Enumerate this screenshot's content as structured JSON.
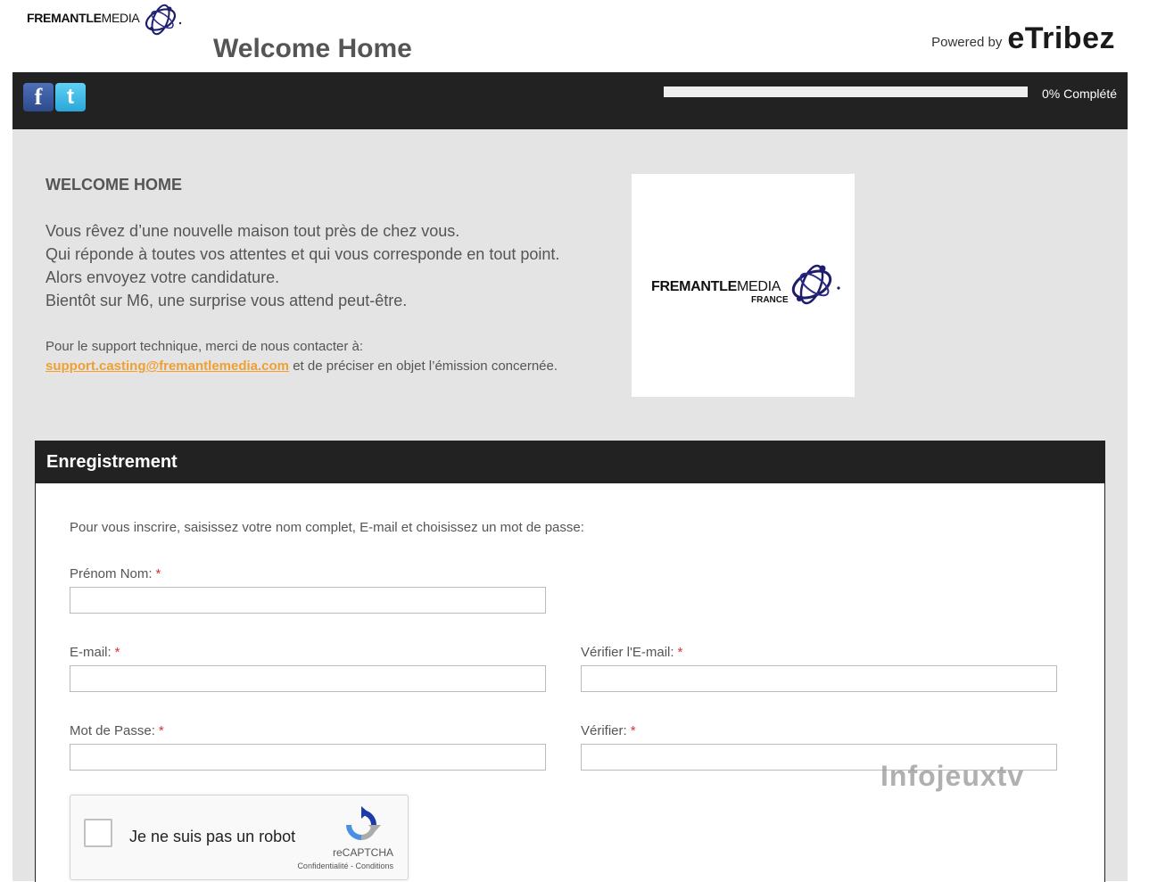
{
  "header": {
    "logo_text_bold": "FREMANTLE",
    "logo_text_light": "MEDIA",
    "title": "Welcome Home",
    "powered_by_label": "Powered by",
    "powered_by_brand": "eTribez"
  },
  "topbar": {
    "progress_value": 0,
    "progress_text": "0% Complété"
  },
  "intro": {
    "heading": "WELCOME HOME",
    "lines": [
      "Vous rêvez d’une nouvelle maison tout près de chez vous.",
      "Qui réponde à toutes vos attentes et qui vous corresponde en tout point.",
      "Alors envoyez votre candidature.",
      "Bientôt sur M6, une surprise vous attend peut-être."
    ],
    "support_prefix": "Pour le support technique, merci de nous contacter à:",
    "support_email": "support.casting@fremantlemedia.com",
    "support_suffix": "et de préciser en objet l’émission concernée."
  },
  "logo_box": {
    "text_bold": "FREMANTLE",
    "text_light": "MEDIA",
    "subtitle": "FRANCE"
  },
  "registration": {
    "title": "Enregistrement",
    "instructions": "Pour vous inscrire, saisissez votre nom complet, E-mail et choisissez un mot de passe:",
    "required_marker": "*",
    "fields": {
      "full_name": {
        "label": "Prénom Nom:",
        "value": ""
      },
      "email": {
        "label": "E-mail:",
        "value": ""
      },
      "email_verify": {
        "label": "Vérifier l'E-mail:",
        "value": ""
      },
      "password": {
        "label": "Mot de Passe:",
        "value": ""
      },
      "password_verify": {
        "label": "Vérifier:",
        "value": ""
      }
    },
    "captcha": {
      "label": "Je ne suis pas un robot",
      "brand": "reCAPTCHA",
      "links": "Confidentialité - Conditions"
    }
  },
  "watermark": "Infojeuxtv",
  "colors": {
    "dark_bar": "#222222",
    "content_bg": "#e4e4e4",
    "accent_link": "#f0a030",
    "required": "#dd3333"
  }
}
